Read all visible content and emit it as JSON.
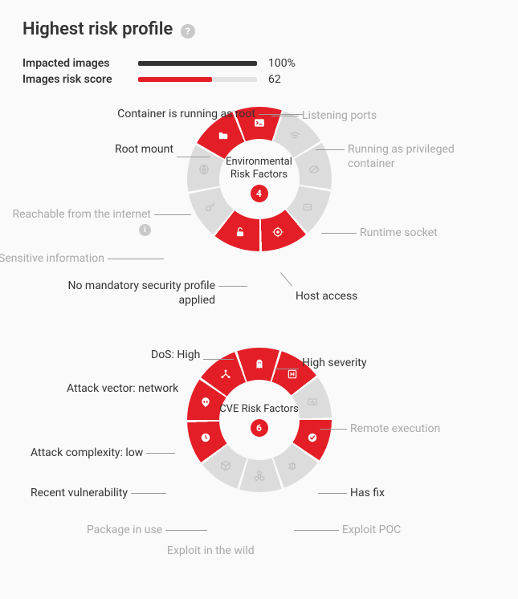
{
  "title": "Highest risk profile",
  "metrics": {
    "impacted_label": "Impacted images",
    "impacted_value": "100%",
    "impacted_pct": 100,
    "impacted_color": "#333333",
    "risk_label": "Images risk score",
    "risk_value": "62",
    "risk_pct": 62,
    "risk_color": "#e41e26"
  },
  "colors": {
    "active": "#e41e26",
    "inactive_bg": "#dcdcdc",
    "inactive_icon": "#bfbfbf",
    "active_icon": "#ffffff"
  },
  "chart_data": [
    {
      "type": "pie",
      "title": "Environmental Risk Factors",
      "count": 4,
      "segments": [
        {
          "name": "Container is running as root",
          "active": true,
          "icon": "terminal-icon"
        },
        {
          "name": "Listening ports",
          "active": false,
          "icon": "wifi-icon"
        },
        {
          "name": "Running as privileged container",
          "active": false,
          "icon": "eye-off-icon"
        },
        {
          "name": "Runtime socket",
          "active": false,
          "icon": "socket-icon"
        },
        {
          "name": "Host access",
          "active": true,
          "icon": "target-icon"
        },
        {
          "name": "No mandatory security profile applied",
          "active": true,
          "icon": "unlock-icon"
        },
        {
          "name": "Sensitive information",
          "active": false,
          "icon": "key-icon"
        },
        {
          "name": "Reachable from the internet",
          "active": false,
          "icon": "globe-icon",
          "help": true
        },
        {
          "name": "Root mount",
          "active": true,
          "icon": "folder-icon"
        }
      ]
    },
    {
      "type": "pie",
      "title": "CVE Risk Factors",
      "count": 6,
      "segments": [
        {
          "name": "DoS: High",
          "active": true,
          "icon": "ghost-icon"
        },
        {
          "name": "High severity",
          "active": true,
          "icon": "h-icon"
        },
        {
          "name": "Remote execution",
          "active": false,
          "icon": "remote-icon"
        },
        {
          "name": "Has fix",
          "active": true,
          "icon": "check-icon"
        },
        {
          "name": "Exploit POC",
          "active": false,
          "icon": "bug-icon"
        },
        {
          "name": "Exploit in the wild",
          "active": false,
          "icon": "biohazard-icon"
        },
        {
          "name": "Package in use",
          "active": false,
          "icon": "package-icon"
        },
        {
          "name": "Recent vulnerability",
          "active": true,
          "icon": "clock-icon"
        },
        {
          "name": "Attack complexity: low",
          "active": true,
          "icon": "alien-icon"
        },
        {
          "name": "Attack vector: network",
          "active": true,
          "icon": "network-icon"
        }
      ]
    }
  ]
}
